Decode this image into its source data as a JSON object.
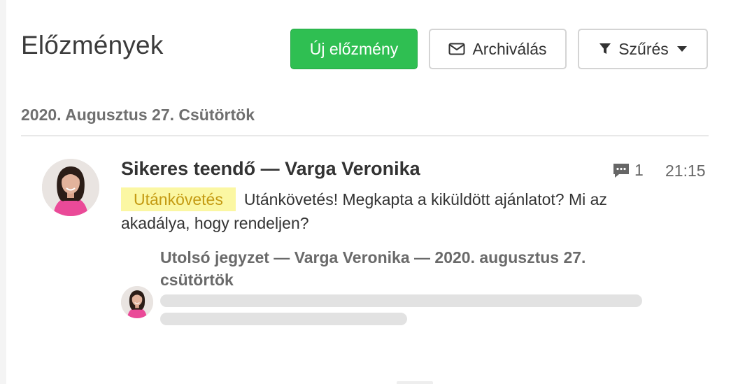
{
  "header": {
    "title": "Előzmények",
    "new_button_label": "Új előzmény",
    "archive_button_label": "Archiválás",
    "filter_button_label": "Szűrés"
  },
  "date_group": {
    "heading": "2020. Augusztus 27. Csütörtök"
  },
  "activity": {
    "title": "Sikeres teendő — Varga Veronika",
    "comment_count": "1",
    "time": "21:15",
    "tag": "Utánkövetés",
    "text": "Utánkövetés! Megkapta a kiküldött ajánlatot? Mi az akadálya, hogy rendeljen?",
    "last_note_header": "Utolsó jegyzet — Varga Veronika — 2020. augusztus 27. csütörtök"
  },
  "colors": {
    "primary": "#2fbf52",
    "tag_background": "#fbf7a3",
    "tag_text": "#c49a12"
  },
  "icons": {
    "archive": "envelope-icon",
    "filter": "filter-icon",
    "dropdown": "caret-down-icon",
    "comment": "comment-icon"
  }
}
